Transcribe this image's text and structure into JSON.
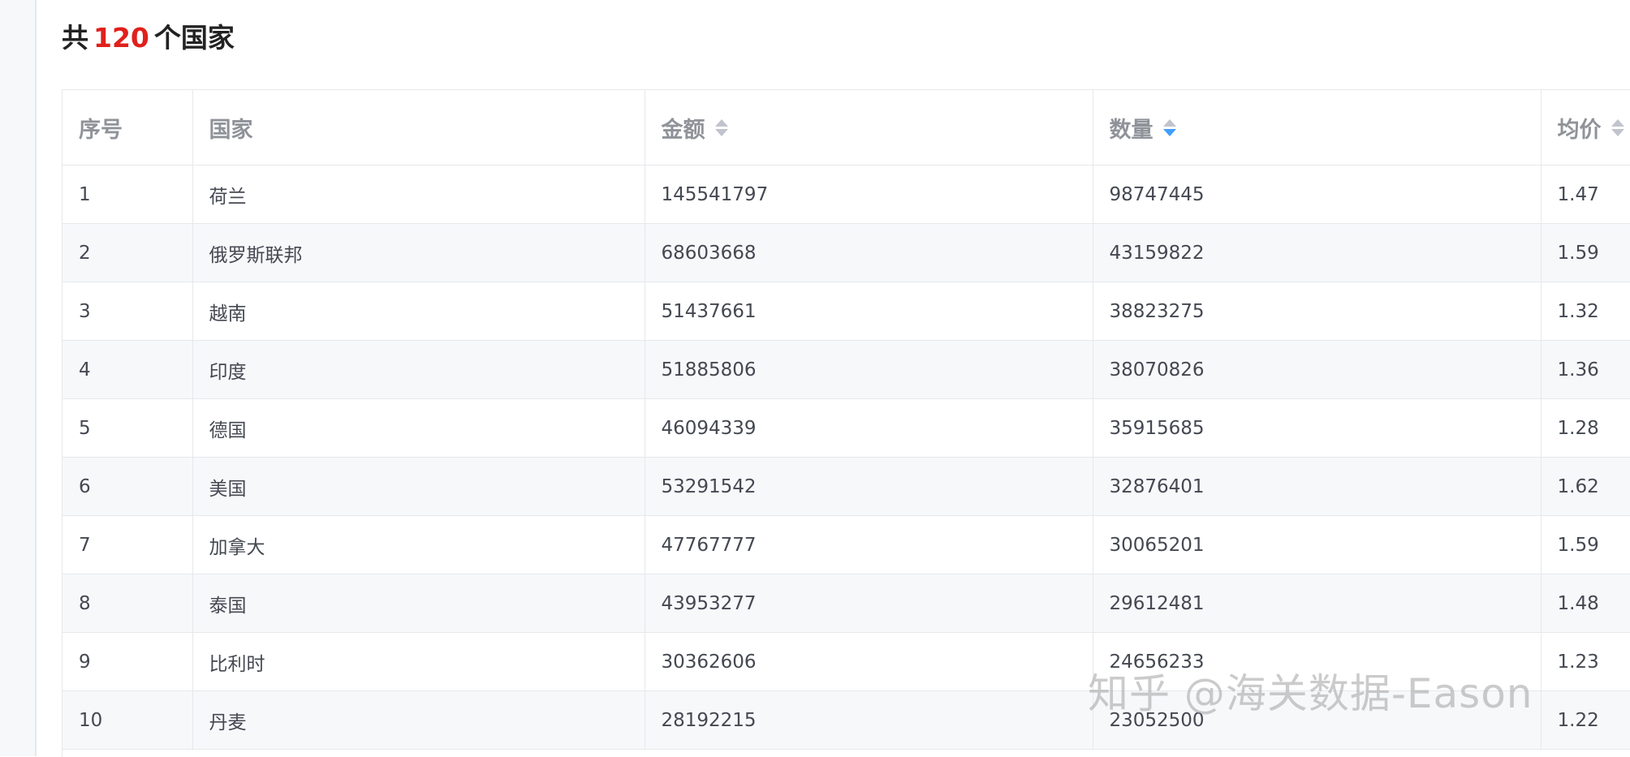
{
  "summary": {
    "prefix": "共",
    "count": "120",
    "suffix": "个国家"
  },
  "colors": {
    "count_red": "#e0201c",
    "sort_active": "#409eff",
    "sort_inactive": "#c0c4cc",
    "stripe": "#f7f8fa"
  },
  "table": {
    "headers": {
      "index": "序号",
      "country": "国家",
      "amount": "金额",
      "quantity": "数量",
      "avg_price": "均价"
    },
    "sort_icons": {
      "amount": "sort-neutral-icon",
      "quantity": "sort-descending-icon",
      "avg_price": "sort-neutral-icon"
    },
    "rows": [
      {
        "index": "1",
        "country": "荷兰",
        "amount": "145541797",
        "quantity": "98747445",
        "avg_price": "1.47"
      },
      {
        "index": "2",
        "country": "俄罗斯联邦",
        "amount": "68603668",
        "quantity": "43159822",
        "avg_price": "1.59"
      },
      {
        "index": "3",
        "country": "越南",
        "amount": "51437661",
        "quantity": "38823275",
        "avg_price": "1.32"
      },
      {
        "index": "4",
        "country": "印度",
        "amount": "51885806",
        "quantity": "38070826",
        "avg_price": "1.36"
      },
      {
        "index": "5",
        "country": "德国",
        "amount": "46094339",
        "quantity": "35915685",
        "avg_price": "1.28"
      },
      {
        "index": "6",
        "country": "美国",
        "amount": "53291542",
        "quantity": "32876401",
        "avg_price": "1.62"
      },
      {
        "index": "7",
        "country": "加拿大",
        "amount": "47767777",
        "quantity": "30065201",
        "avg_price": "1.59"
      },
      {
        "index": "8",
        "country": "泰国",
        "amount": "43953277",
        "quantity": "29612481",
        "avg_price": "1.48"
      },
      {
        "index": "9",
        "country": "比利时",
        "amount": "30362606",
        "quantity": "24656233",
        "avg_price": "1.23"
      },
      {
        "index": "10",
        "country": "丹麦",
        "amount": "28192215",
        "quantity": "23052500",
        "avg_price": "1.22"
      }
    ]
  },
  "watermark": "知乎 @海关数据-Eason"
}
